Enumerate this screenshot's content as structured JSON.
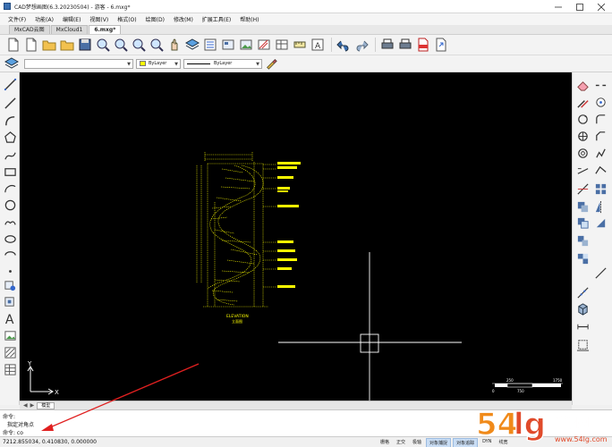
{
  "window": {
    "title": "CAD梦想画图(6.3.20230504) - 游客 - 6.mxg*",
    "controls": [
      "minimize",
      "maximize",
      "close"
    ]
  },
  "menu": [
    "文件(F)",
    "功能(A)",
    "编辑(E)",
    "视图(V)",
    "格式(O)",
    "绘图(D)",
    "修改(M)",
    "扩展工具(E)",
    "帮助(H)"
  ],
  "tabs": [
    {
      "label": "MxCAD云图",
      "active": false
    },
    {
      "label": "MxCloud1",
      "active": false
    },
    {
      "label": "6.mxg*",
      "active": true
    }
  ],
  "properties": {
    "layer_value": "",
    "color_value": "ByLayer",
    "color_hex": "#ffff00",
    "linetype_value": "ByLayer"
  },
  "canvas": {
    "background": "#000000",
    "drawing_color": "#ffff00",
    "drawing_title": "ELEVATION",
    "drawing_subtitle": "立面图",
    "scale_labels": [
      "0",
      "250",
      "750",
      "1750"
    ]
  },
  "layout": {
    "tab_label": "模型"
  },
  "command": {
    "lines": [
      "命令:",
      "指定对角点",
      "命令:  co"
    ]
  },
  "status": {
    "coordinates": "7212.855034,  0.410830,  0.000000",
    "buttons": [
      {
        "label": "栅格",
        "on": false
      },
      {
        "label": "正交",
        "on": false
      },
      {
        "label": "极轴",
        "on": false
      },
      {
        "label": "对象捕捉",
        "on": true
      },
      {
        "label": "对象追踪",
        "on": true
      },
      {
        "label": "DYN",
        "on": false
      },
      {
        "label": "线宽",
        "on": false
      }
    ]
  },
  "watermark": {
    "brand": "54lg手游网",
    "url": "www.54lg.com"
  }
}
